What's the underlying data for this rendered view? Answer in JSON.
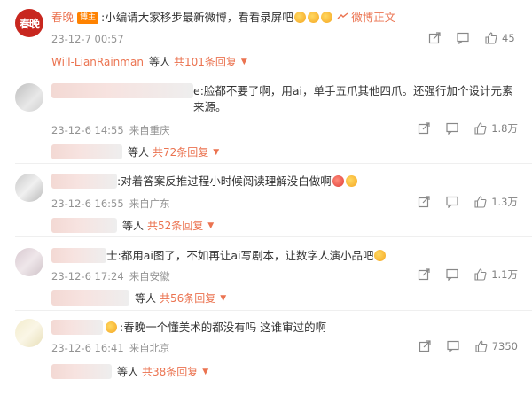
{
  "comments": [
    {
      "username": "春晚",
      "badge": "博主",
      "avatar_text": "春晚",
      "text": ":小编请大家移步最新微博，看看录屏吧",
      "link": "微博正文",
      "time": "23-12-7 00:57",
      "location": "",
      "likes": "45",
      "reply_name": "Will-LianRainman",
      "reply_etc": "等人",
      "reply_total": "共101条回复"
    },
    {
      "text": "e:脸都不要了啊，用ai，单手五爪其他四爪。还强行加个设计元素来源。",
      "time": "23-12-6 14:55",
      "location": "来自重庆",
      "likes": "1.8万",
      "reply_etc": "等人",
      "reply_total": "共72条回复"
    },
    {
      "text": ":对着答案反推过程小时候阅读理解没白做啊",
      "time": "23-12-6 16:55",
      "location": "来自广东",
      "likes": "1.3万",
      "reply_etc": "等人",
      "reply_total": "共52条回复"
    },
    {
      "text": "士:都用ai图了，不如再让ai写剧本，让数字人演小品吧",
      "time": "23-12-6 17:24",
      "location": "来自安徽",
      "likes": "1.1万",
      "reply_etc": "等人",
      "reply_total": "共56条回复"
    },
    {
      "text": ":春晚一个懂美术的都没有吗  这谁审过的啊",
      "time": "23-12-6 16:41",
      "location": "来自北京",
      "likes": "7350",
      "reply_etc": "等人",
      "reply_total": "共38条回复"
    }
  ],
  "icons": {
    "share": "share-icon",
    "comment": "comment-icon",
    "like": "like-icon",
    "caret": "caret-down-icon"
  },
  "colors": {
    "accent": "#eb7350",
    "badge": "#ff8200",
    "meta": "#939393"
  }
}
